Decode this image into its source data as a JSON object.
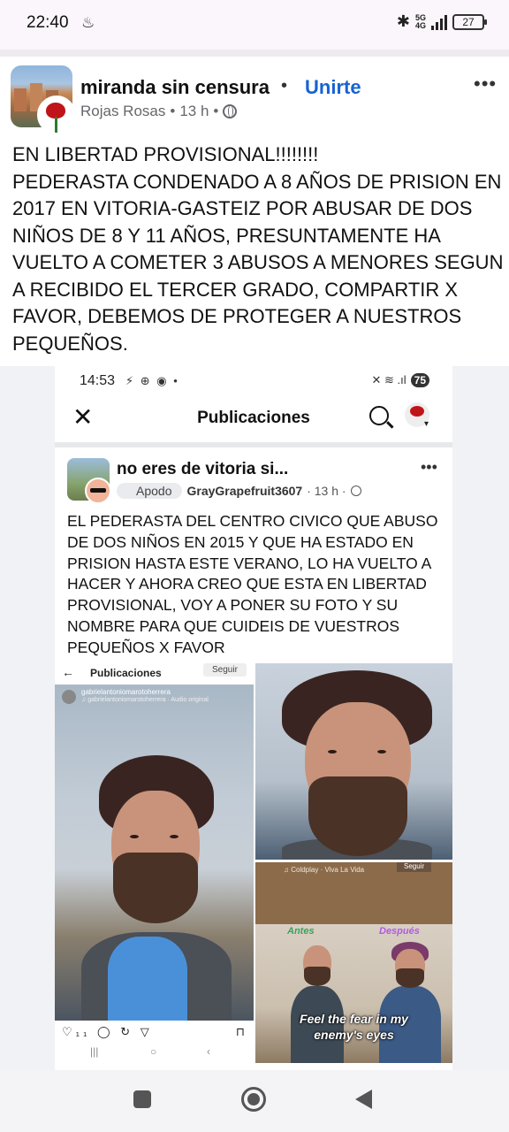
{
  "status_bar": {
    "time": "22:40",
    "network_top": "5G",
    "network_bottom": "4G",
    "battery": "27",
    "icons": [
      "cloud-flame-icon",
      "bluetooth-icon",
      "signal-icon",
      "battery-icon"
    ]
  },
  "post": {
    "group_name": "miranda sin censura",
    "separator": "•",
    "join_label": "Unirte",
    "author": "Rojas Rosas",
    "time": "13 h",
    "more_label": "•••",
    "text": "EN LIBERTAD PROVISIONAL!!!!!!!!\nPEDERASTA CONDENADO A 8 AÑOS DE PRISION EN 2017 EN VITORIA-GASTEIZ POR ABUSAR DE DOS NIÑOS DE 8 Y 11 AÑOS, PRESUNTAMENTE HA VUELTO A COMETER 3 ABUSOS A MENORES SEGUN A RECIBIDO EL TERCER GRADO, COMPARTIR X FAVOR, DEBEMOS DE PROTEGER A NUESTROS PEQUEÑOS."
  },
  "embedded": {
    "status_time": "14:53",
    "status_icons": "⚡ ⊕ ◉ •",
    "status_right": "✕ ≋ .ıl",
    "battery": "75",
    "nav_title": "Publicaciones",
    "close_label": "✕",
    "group_name": "no eres de vitoria si...",
    "badge": "Apodo",
    "author": "GrayGrapefruit3607",
    "time": "· 13 h ·",
    "more_label": "•••",
    "text": "EL PEDERASTA DEL CENTRO CIVICO QUE ABUSO DE DOS NIÑOS EN 2015 Y QUE HA ESTADO EN PRISION HASTA ESTE VERANO, LO HA VUELTO A HACER Y AHORA CREO QUE ESTA EN LIBERTAD PROVISIONAL, VOY A PONER SU FOTO Y SU NOMBRE PARA QUE CUIDEIS DE VUESTROS PEQUEÑOS X FAVOR",
    "photo_a": {
      "back": "←",
      "title": "Publicaciones",
      "follow": "Seguir",
      "username": "gabrielantoniomarotoherrera",
      "audio": "♫ gabrielantoniomarotoherrera · Audio original",
      "actions": "♡₁₁ ◯ ↻ ▽",
      "bookmark": "⊓",
      "nav": [
        "|||",
        "○",
        "‹"
      ]
    },
    "photo_c": {
      "song": "♫ Coldplay · Viva La Vida",
      "follow": "Seguir",
      "antes": "Antes",
      "despues": "Después",
      "caption": "Feel the fear in my\nenemy's eyes"
    }
  },
  "colors": {
    "link_blue": "#1763d1",
    "text": "#111111",
    "secondary_text": "#65676b",
    "status_bar_bg": "#fbf6fb"
  }
}
